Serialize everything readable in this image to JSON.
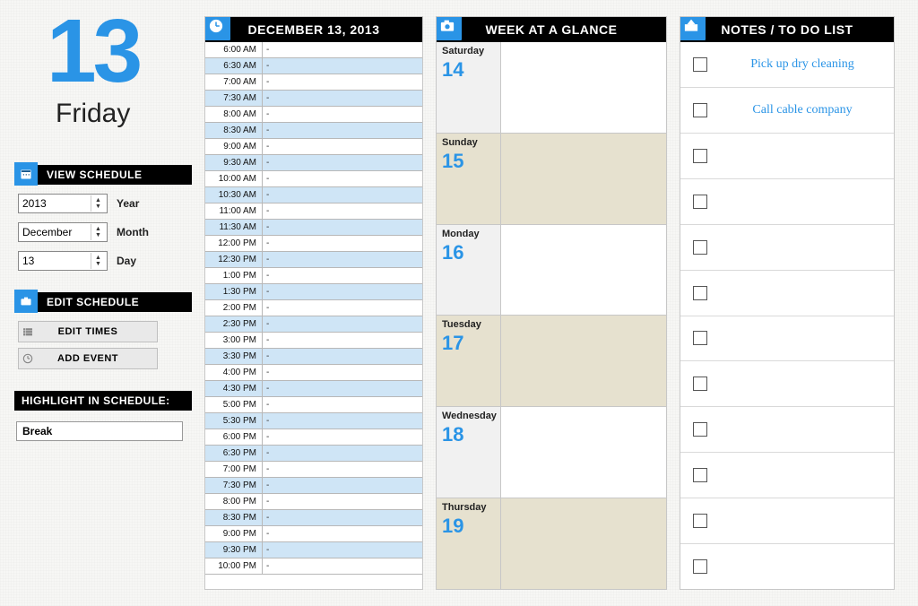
{
  "date": {
    "day_number": "13",
    "weekday_long": "Friday",
    "full_date": "DECEMBER 13, 2013"
  },
  "sidebar": {
    "view_schedule_label": "VIEW SCHEDULE",
    "edit_schedule_label": "EDIT SCHEDULE",
    "highlight_label": "HIGHLIGHT IN SCHEDULE:",
    "year": {
      "value": "2013",
      "label": "Year"
    },
    "month": {
      "value": "December",
      "label": "Month"
    },
    "day": {
      "value": "13",
      "label": "Day"
    },
    "edit_times_label": "EDIT TIMES",
    "add_event_label": "ADD EVENT",
    "highlight_value": "Break"
  },
  "day_schedule": {
    "slots": [
      {
        "time": "6:00 AM",
        "value": "-"
      },
      {
        "time": "6:30 AM",
        "value": "-"
      },
      {
        "time": "7:00 AM",
        "value": "-"
      },
      {
        "time": "7:30 AM",
        "value": "-"
      },
      {
        "time": "8:00 AM",
        "value": "-"
      },
      {
        "time": "8:30 AM",
        "value": "-"
      },
      {
        "time": "9:00 AM",
        "value": "-"
      },
      {
        "time": "9:30 AM",
        "value": "-"
      },
      {
        "time": "10:00 AM",
        "value": "-"
      },
      {
        "time": "10:30 AM",
        "value": "-"
      },
      {
        "time": "11:00 AM",
        "value": "-"
      },
      {
        "time": "11:30 AM",
        "value": "-"
      },
      {
        "time": "12:00 PM",
        "value": "-"
      },
      {
        "time": "12:30 PM",
        "value": "-"
      },
      {
        "time": "1:00 PM",
        "value": "-"
      },
      {
        "time": "1:30 PM",
        "value": "-"
      },
      {
        "time": "2:00 PM",
        "value": "-"
      },
      {
        "time": "2:30 PM",
        "value": "-"
      },
      {
        "time": "3:00 PM",
        "value": "-"
      },
      {
        "time": "3:30 PM",
        "value": "-"
      },
      {
        "time": "4:00 PM",
        "value": "-"
      },
      {
        "time": "4:30 PM",
        "value": "-"
      },
      {
        "time": "5:00 PM",
        "value": "-"
      },
      {
        "time": "5:30 PM",
        "value": "-"
      },
      {
        "time": "6:00 PM",
        "value": "-"
      },
      {
        "time": "6:30 PM",
        "value": "-"
      },
      {
        "time": "7:00 PM",
        "value": "-"
      },
      {
        "time": "7:30 PM",
        "value": "-"
      },
      {
        "time": "8:00 PM",
        "value": "-"
      },
      {
        "time": "8:30 PM",
        "value": "-"
      },
      {
        "time": "9:00 PM",
        "value": "-"
      },
      {
        "time": "9:30 PM",
        "value": "-"
      },
      {
        "time": "10:00 PM",
        "value": "-"
      }
    ]
  },
  "week": {
    "title": "WEEK AT A GLANCE",
    "days": [
      {
        "dow": "Saturday",
        "num": "14",
        "alt": false
      },
      {
        "dow": "Sunday",
        "num": "15",
        "alt": true
      },
      {
        "dow": "Monday",
        "num": "16",
        "alt": false
      },
      {
        "dow": "Tuesday",
        "num": "17",
        "alt": true
      },
      {
        "dow": "Wednesday",
        "num": "18",
        "alt": false
      },
      {
        "dow": "Thursday",
        "num": "19",
        "alt": true
      }
    ]
  },
  "notes": {
    "title": "NOTES / TO DO LIST",
    "items": [
      {
        "text": "Pick up dry cleaning"
      },
      {
        "text": "Call cable company"
      },
      {
        "text": ""
      },
      {
        "text": ""
      },
      {
        "text": ""
      },
      {
        "text": ""
      },
      {
        "text": ""
      },
      {
        "text": ""
      },
      {
        "text": ""
      },
      {
        "text": ""
      },
      {
        "text": ""
      },
      {
        "text": ""
      }
    ]
  }
}
